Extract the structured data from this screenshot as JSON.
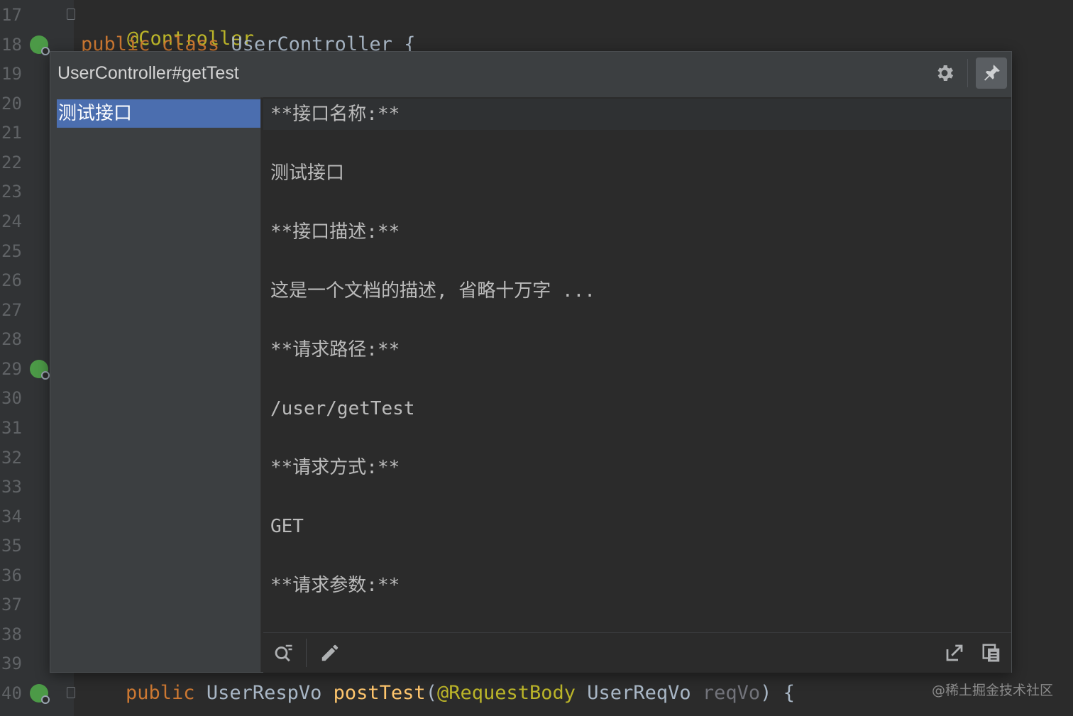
{
  "editor": {
    "line_numbers": [
      "17",
      "18",
      "19",
      "20",
      "21",
      "22",
      "23",
      "24",
      "25",
      "26",
      "27",
      "28",
      "29",
      "30",
      "31",
      "32",
      "33",
      "34",
      "35",
      "36",
      "37",
      "38",
      "39",
      "40"
    ],
    "line17": {
      "annotation": "@Controller"
    },
    "line18": {
      "kw1": "public",
      "kw2": "class",
      "name": "UserController",
      "brace": "{"
    },
    "line40": {
      "kw": "public",
      "type": "UserRespVo",
      "method": "postTest",
      "open": "(",
      "annotation": "@RequestBody",
      "param_type": "UserReqVo",
      "param_name": "reqVo",
      "close": ")",
      "brace": "{"
    }
  },
  "popup": {
    "title": "UserController#getTest",
    "list": [
      {
        "label": "测试接口",
        "selected": true
      }
    ],
    "content_lines": [
      "**接口名称:**",
      "测试接口",
      "**接口描述:**",
      "这是一个文档的描述, 省略十万字 ...",
      "**请求路径:**",
      "/user/getTest",
      "**请求方式:**",
      "GET",
      "**请求参数:**"
    ],
    "header_icons": [
      "gear-icon",
      "pin-icon"
    ],
    "footer_icons": [
      "search-doc-icon",
      "pencil-icon",
      "external-link-icon",
      "copy-icon"
    ]
  },
  "watermark": "@稀土掘金技术社区",
  "colors": {
    "editor_bg": "#2b2b2b",
    "panel_bg": "#3c3f41",
    "selection": "#4b6eaf",
    "keyword": "#cc7832",
    "annotation": "#bbb529",
    "method": "#ffc66d"
  }
}
